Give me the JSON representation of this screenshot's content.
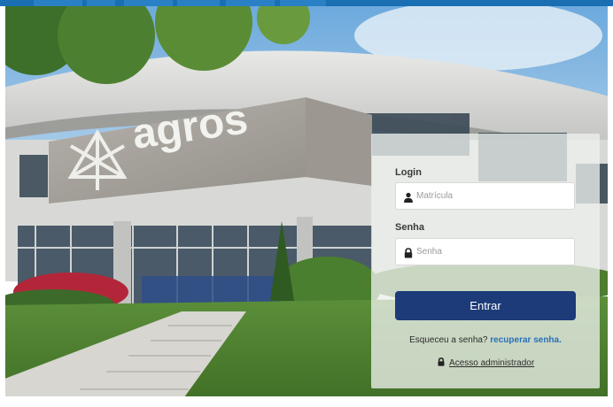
{
  "background": {
    "building_logo_text": "agros"
  },
  "login": {
    "login_label": "Login",
    "matricula_placeholder": "Matrícula",
    "senha_label": "Senha",
    "senha_placeholder": "Senha",
    "submit_label": "Entrar",
    "forgot_text": "Esqueceu a senha?",
    "recover_link": "recuperar senha.",
    "admin_link": "Acesso administrador"
  },
  "icons": {
    "user": "user-icon",
    "lock": "lock-icon",
    "admin_lock": "lock-icon"
  },
  "colors": {
    "topbar": "#1a6fb3",
    "submit_button": "#1d3a79",
    "link": "#2a6fb8"
  }
}
